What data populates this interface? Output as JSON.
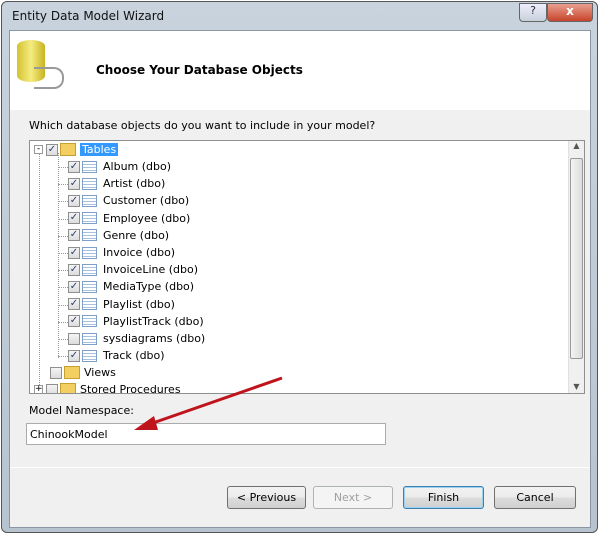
{
  "window": {
    "title": "Entity Data Model Wizard",
    "help": "?",
    "close": "x"
  },
  "header": {
    "title": "Choose Your Database Objects"
  },
  "question": "Which database objects do you want to include in your model?",
  "tree": {
    "root": {
      "label": "Tables",
      "checked": true
    },
    "tables": [
      {
        "label": "Album (dbo)",
        "checked": true
      },
      {
        "label": "Artist (dbo)",
        "checked": true
      },
      {
        "label": "Customer (dbo)",
        "checked": true
      },
      {
        "label": "Employee (dbo)",
        "checked": true
      },
      {
        "label": "Genre (dbo)",
        "checked": true
      },
      {
        "label": "Invoice (dbo)",
        "checked": true
      },
      {
        "label": "InvoiceLine (dbo)",
        "checked": true
      },
      {
        "label": "MediaType (dbo)",
        "checked": true
      },
      {
        "label": "Playlist (dbo)",
        "checked": true
      },
      {
        "label": "PlaylistTrack (dbo)",
        "checked": true
      },
      {
        "label": "sysdiagrams (dbo)",
        "checked": false
      },
      {
        "label": "Track (dbo)",
        "checked": true
      }
    ],
    "views": {
      "label": "Views",
      "checked": false
    },
    "procs": {
      "label": "Stored Procedures",
      "checked": false
    }
  },
  "namespace": {
    "label": "Model Namespace:",
    "value": "ChinookModel"
  },
  "buttons": {
    "previous": "< Previous",
    "next": "Next >",
    "finish": "Finish",
    "cancel": "Cancel"
  },
  "colors": {
    "arrow": "#c0141c",
    "selection": "#3399ff"
  }
}
